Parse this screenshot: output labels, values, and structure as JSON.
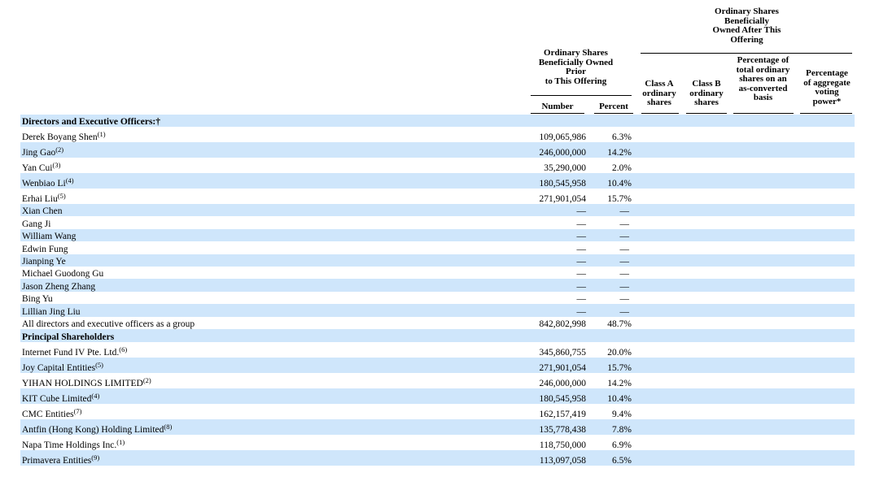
{
  "headers": {
    "prior_group": [
      "Ordinary Shares",
      "Beneficially Owned",
      "Prior",
      "to This Offering"
    ],
    "after_group": [
      "Ordinary Shares",
      "Beneficially",
      "Owned After This",
      "Offering"
    ],
    "number": "Number",
    "percent": "Percent",
    "class_a": [
      "Class A",
      "ordinary",
      "shares"
    ],
    "class_b": [
      "Class B",
      "ordinary",
      "shares"
    ],
    "pct_total": [
      "Percentage of",
      "total ordinary",
      "shares on an",
      "as-converted",
      "basis"
    ],
    "pct_voting": [
      "Percentage",
      "of aggregate",
      "voting",
      "power*"
    ]
  },
  "rows": [
    {
      "type": "section",
      "name": "Directors and Executive Officers:†",
      "shade": true
    },
    {
      "name": "Derek Boyang Shen",
      "note": "(1)",
      "number": "109,065,986",
      "percent": "6.3%",
      "shade": false
    },
    {
      "name": "Jing Gao",
      "note": "(2)",
      "number": "246,000,000",
      "percent": "14.2%",
      "shade": true
    },
    {
      "name": "Yan Cui",
      "note": "(3)",
      "number": "35,290,000",
      "percent": "2.0%",
      "shade": false
    },
    {
      "name": "Wenbiao Li",
      "note": "(4)",
      "number": "180,545,958",
      "percent": "10.4%",
      "shade": true
    },
    {
      "name": "Erhai Liu",
      "note": "(5)",
      "number": "271,901,054",
      "percent": "15.7%",
      "shade": false
    },
    {
      "name": "Xian Chen",
      "note": "",
      "number": "—",
      "percent": "—",
      "shade": true
    },
    {
      "name": "Gang Ji",
      "note": "",
      "number": "—",
      "percent": "—",
      "shade": false
    },
    {
      "name": "William Wang",
      "note": "",
      "number": "—",
      "percent": "—",
      "shade": true
    },
    {
      "name": "Edwin Fung",
      "note": "",
      "number": "—",
      "percent": "—",
      "shade": false
    },
    {
      "name": "Jianping Ye",
      "note": "",
      "number": "—",
      "percent": "—",
      "shade": true
    },
    {
      "name": "Michael Guodong Gu",
      "note": "",
      "number": "—",
      "percent": "—",
      "shade": false
    },
    {
      "name": "Jason Zheng Zhang",
      "note": "",
      "number": "—",
      "percent": "—",
      "shade": true
    },
    {
      "name": "Bing Yu",
      "note": "",
      "number": "—",
      "percent": "—",
      "shade": false
    },
    {
      "name": "Lillian Jing Liu",
      "note": "",
      "number": "—",
      "percent": "—",
      "shade": true
    },
    {
      "name": "All directors and executive officers as a group",
      "note": "",
      "number": "842,802,998",
      "percent": "48.7%",
      "shade": false
    },
    {
      "type": "section",
      "name": "Principal Shareholders",
      "shade": true
    },
    {
      "name": "Internet Fund IV Pte. Ltd.",
      "note": "(6)",
      "number": "345,860,755",
      "percent": "20.0%",
      "shade": false
    },
    {
      "name": "Joy Capital Entities",
      "note": "(5)",
      "number": "271,901,054",
      "percent": "15.7%",
      "shade": true
    },
    {
      "name": "YIHAN HOLDINGS LIMITED",
      "note": "(2)",
      "number": "246,000,000",
      "percent": "14.2%",
      "shade": false
    },
    {
      "name": "KIT Cube Limited",
      "note": "(4)",
      "number": "180,545,958",
      "percent": "10.4%",
      "shade": true
    },
    {
      "name": "CMC Entities",
      "note": "(7)",
      "number": "162,157,419",
      "percent": "9.4%",
      "shade": false
    },
    {
      "name": "Antfin (Hong Kong) Holding Limited",
      "note": "(8)",
      "number": "135,778,438",
      "percent": "7.8%",
      "shade": true
    },
    {
      "name": "Napa Time Holdings Inc.",
      "note": "(1)",
      "number": "118,750,000",
      "percent": "6.9%",
      "shade": false
    },
    {
      "name": "Primavera Entities",
      "note": "(9)",
      "number": "113,097,058",
      "percent": "6.5%",
      "shade": true
    }
  ]
}
